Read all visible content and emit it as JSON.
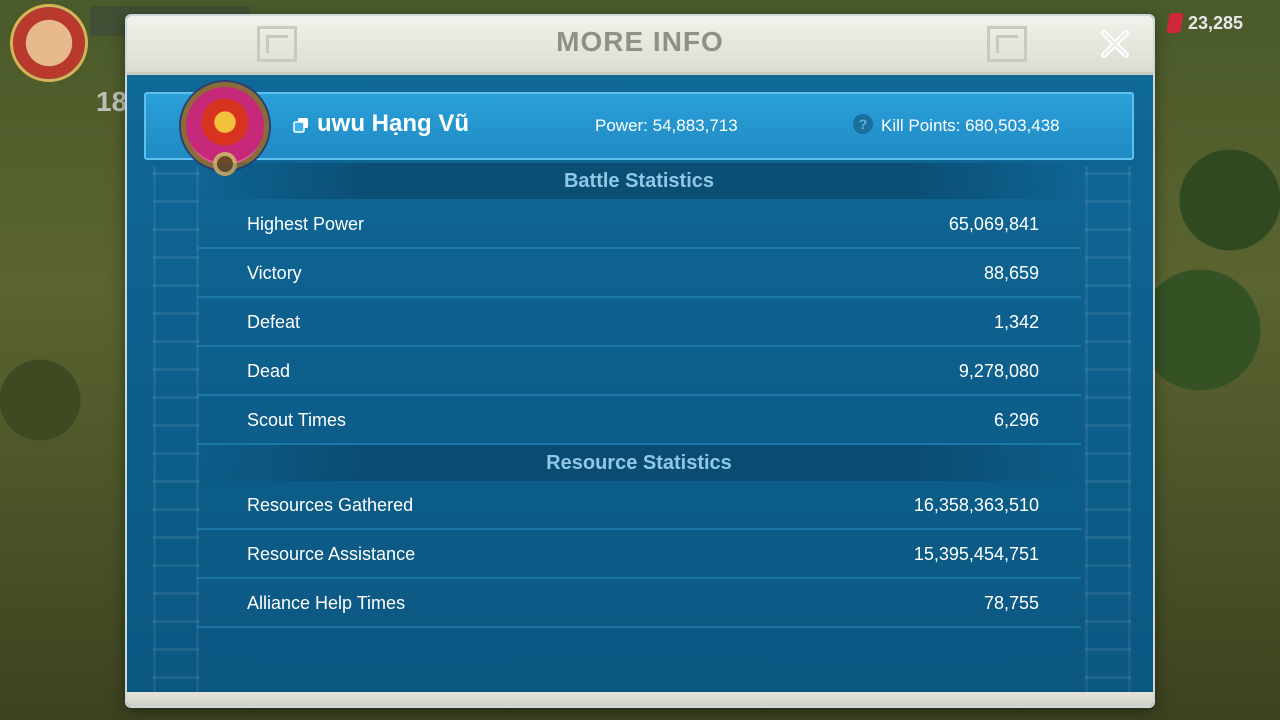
{
  "background": {
    "level_text": "18",
    "currency_value": "23,285"
  },
  "modal": {
    "title": "MORE INFO"
  },
  "player": {
    "name": "uwu Hạng Vũ",
    "power": "Power: 54,883,713",
    "kill_points": "Kill Points: 680,503,438",
    "help_icon": "?"
  },
  "battle_statistics": {
    "title": "Battle Statistics",
    "rows": [
      {
        "label": "Highest Power",
        "value": "65,069,841"
      },
      {
        "label": "Victory",
        "value": "88,659"
      },
      {
        "label": "Defeat",
        "value": "1,342"
      },
      {
        "label": "Dead",
        "value": "9,278,080"
      },
      {
        "label": "Scout Times",
        "value": "6,296"
      }
    ]
  },
  "resource_statistics": {
    "title": "Resource Statistics",
    "rows": [
      {
        "label": "Resources Gathered",
        "value": "16,358,363,510"
      },
      {
        "label": "Resource Assistance",
        "value": "15,395,454,751"
      },
      {
        "label": "Alliance Help Times",
        "value": "78,755"
      }
    ]
  },
  "colors": {
    "modal_bg": "#0d5f8c",
    "banner_bg": "#2ba0d8",
    "header_bg": "#e8e8e0",
    "section_title": "#8fc7e6"
  }
}
